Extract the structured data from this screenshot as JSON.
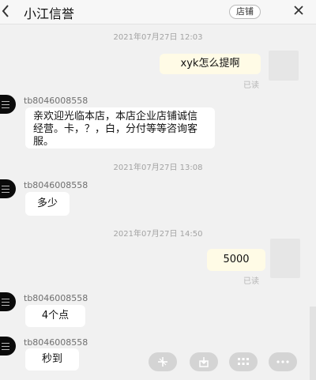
{
  "header": {
    "title": "小江信誉",
    "shop_label": "店铺"
  },
  "messages": [
    {
      "time": "2021年07月27日 12:03"
    },
    {
      "text": "xyk怎么提啊",
      "status": "已读"
    },
    {
      "nick": "tb8046008558",
      "text": "亲欢迎光临本店，本店企业店铺诚信经营。卡，？，白，分付等等咨询客服。"
    },
    {
      "time": "2021年07月27日 13:08"
    },
    {
      "nick": "tb8046008558",
      "text": "多少"
    },
    {
      "time": "2021年07月27日 14:50"
    },
    {
      "text": "5000",
      "status": "已读"
    },
    {
      "nick": "tb8046008558",
      "text": "4个点"
    },
    {
      "nick": "tb8046008558",
      "text": "秒到"
    }
  ],
  "toolbar": [
    "sparkle-icon",
    "download-tray-icon",
    "grid-icon",
    "more-dots-icon"
  ]
}
